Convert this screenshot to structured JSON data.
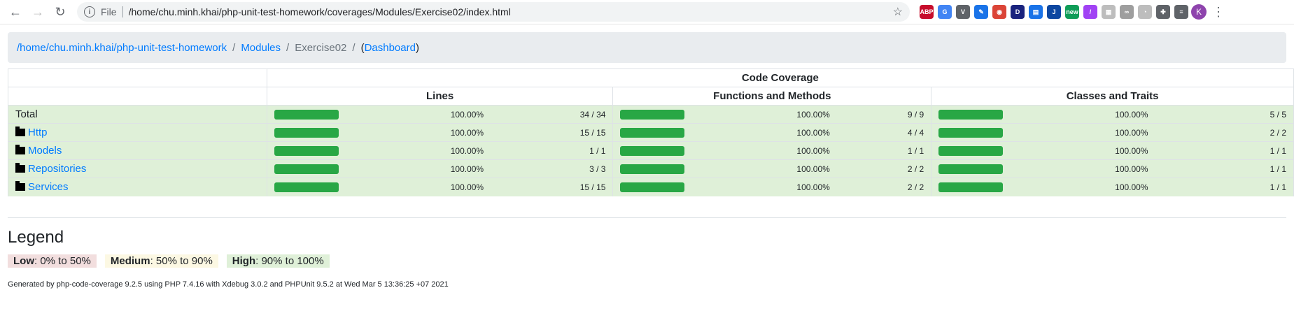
{
  "browser": {
    "file_label": "File",
    "url": "/home/chu.minh.khai/php-unit-test-homework/coverages/Modules/Exercise02/index.html",
    "avatar_letter": "K",
    "extensions": [
      {
        "name": "abp-icon",
        "label": "ABP",
        "color": "#c70d2c"
      },
      {
        "name": "translate-icon",
        "label": "G",
        "color": "#4285f4"
      },
      {
        "name": "vue-devtools-icon",
        "label": "V",
        "color": "#5f6368"
      },
      {
        "name": "eyedropper-icon",
        "label": "✎",
        "color": "#1a73e8"
      },
      {
        "name": "chrome-icon",
        "label": "◉",
        "color": "#db4437"
      },
      {
        "name": "d-extension-icon",
        "label": "D",
        "color": "#1a237e"
      },
      {
        "name": "calendar-icon",
        "label": "▤",
        "color": "#1a73e8"
      },
      {
        "name": "j-extension-icon",
        "label": "J",
        "color": "#0d47a1"
      },
      {
        "name": "new-extension-icon",
        "label": "new",
        "color": "#0f9d58"
      },
      {
        "name": "pen-icon",
        "label": "/",
        "color": "#a142f4"
      },
      {
        "name": "puzzle-grid-icon",
        "label": "▦",
        "color": "#bdbdbd"
      },
      {
        "name": "glasses-icon",
        "label": "∞",
        "color": "#9e9e9e"
      },
      {
        "name": "clock-icon",
        "label": "◔",
        "color": "#bdbdbd"
      },
      {
        "name": "extensions-puzzle-icon",
        "label": "✚",
        "color": "#5f6368"
      },
      {
        "name": "playlist-icon",
        "label": "≡",
        "color": "#5f6368"
      }
    ]
  },
  "breadcrumb": {
    "root": "/home/chu.minh.khai/php-unit-test-homework",
    "modules": "Modules",
    "current": "Exercise02",
    "dashboard": "Dashboard"
  },
  "table": {
    "header_main": "Code Coverage",
    "col_lines": "Lines",
    "col_functions": "Functions and Methods",
    "col_classes": "Classes and Traits",
    "rows": [
      {
        "name": "Total",
        "link": false,
        "lines_pct": "100.00%",
        "lines": "34 / 34",
        "func_pct": "100.00%",
        "func": "9 / 9",
        "cls_pct": "100.00%",
        "cls": "5 / 5"
      },
      {
        "name": "Http",
        "link": true,
        "lines_pct": "100.00%",
        "lines": "15 / 15",
        "func_pct": "100.00%",
        "func": "4 / 4",
        "cls_pct": "100.00%",
        "cls": "2 / 2"
      },
      {
        "name": "Models",
        "link": true,
        "lines_pct": "100.00%",
        "lines": "1 / 1",
        "func_pct": "100.00%",
        "func": "1 / 1",
        "cls_pct": "100.00%",
        "cls": "1 / 1"
      },
      {
        "name": "Repositories",
        "link": true,
        "lines_pct": "100.00%",
        "lines": "3 / 3",
        "func_pct": "100.00%",
        "func": "2 / 2",
        "cls_pct": "100.00%",
        "cls": "1 / 1"
      },
      {
        "name": "Services",
        "link": true,
        "lines_pct": "100.00%",
        "lines": "15 / 15",
        "func_pct": "100.00%",
        "func": "2 / 2",
        "cls_pct": "100.00%",
        "cls": "1 / 1"
      }
    ]
  },
  "legend": {
    "title": "Legend",
    "low_label": "Low",
    "low_range": ": 0% to 50%",
    "medium_label": "Medium",
    "medium_range": ": 50% to 90%",
    "high_label": "High",
    "high_range": ": 90% to 100%"
  },
  "footer": {
    "text": "Generated by php-code-coverage 9.2.5 using PHP 7.4.16 with Xdebug 3.0.2 and PHPUnit 9.5.2 at Wed Mar 5 13:36:25 +07 2021"
  },
  "colors": {
    "success_row": "#dff0d8",
    "bar": "#28a745",
    "link": "#007bff"
  }
}
